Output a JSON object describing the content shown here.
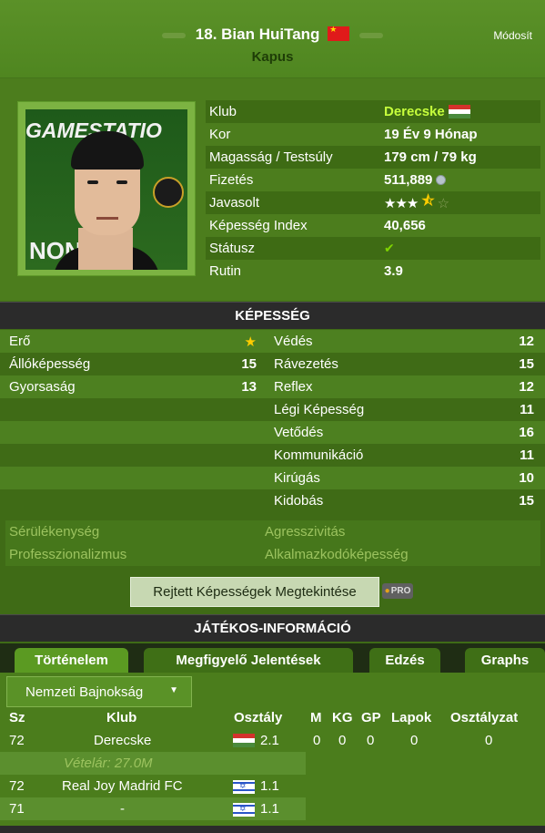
{
  "header": {
    "player_title": "18. Bian HuiTang",
    "position": "Kapus",
    "edit_label": "Módosít"
  },
  "avatar": {
    "banner_top": "GAMESTATIO",
    "banner_bottom": "NON"
  },
  "info": [
    {
      "label": "Klub",
      "value": "Derecske",
      "type": "club"
    },
    {
      "label": "Kor",
      "value": "19 Év 9 Hónap"
    },
    {
      "label": "Magasság / Testsúly",
      "value": "179 cm / 79 kg"
    },
    {
      "label": "Fizetés",
      "value": "511,889",
      "type": "salary"
    },
    {
      "label": "Javasolt",
      "value": "",
      "type": "stars",
      "rating": 3.5,
      "max": 5
    },
    {
      "label": "Képesség Index",
      "value": "40,656"
    },
    {
      "label": "Státusz",
      "value": "",
      "type": "status"
    },
    {
      "label": "Rutin",
      "value": "3.9"
    }
  ],
  "sections": {
    "skills_title": "KÉPESSÉG",
    "player_info_title": "JÁTÉKOS-INFORMÁCIÓ"
  },
  "skills_left": [
    {
      "name": "Erő",
      "value": "★"
    },
    {
      "name": "Állóképesség",
      "value": "15"
    },
    {
      "name": "Gyorsaság",
      "value": "13"
    }
  ],
  "skills_right": [
    {
      "name": "Védés",
      "value": "12"
    },
    {
      "name": "Rávezetés",
      "value": "15"
    },
    {
      "name": "Reflex",
      "value": "12"
    },
    {
      "name": "Légi Képesség",
      "value": "11"
    },
    {
      "name": "Vetődés",
      "value": "16"
    },
    {
      "name": "Kommunikáció",
      "value": "11"
    },
    {
      "name": "Kirúgás",
      "value": "10"
    },
    {
      "name": "Kidobás",
      "value": "15"
    }
  ],
  "hidden_skills": [
    [
      "Sérülékenység",
      "Agresszivitás"
    ],
    [
      "Professzionalizmus",
      "Alkalmazkodóképesség"
    ]
  ],
  "hidden_button": "Rejtett Képességek Megtekintése",
  "pro_badge": "PRO",
  "tabs": [
    "Történelem",
    "Megfigyelő Jelentések",
    "Edzés",
    "Graphs"
  ],
  "history": {
    "dropdown": "Nemzeti Bajnokság",
    "headers": {
      "sz": "Sz",
      "klub": "Klub",
      "osztaly": "Osztály",
      "m": "M",
      "kg": "KG",
      "gp": "GP",
      "lapok": "Lapok",
      "osztalyzat": "Osztályzat"
    },
    "rows": [
      {
        "sz": "72",
        "klub": "Derecske",
        "flag": "hu",
        "osztaly": "2.1",
        "m": "0",
        "kg": "0",
        "gp": "0",
        "lapok": "0",
        "osztalyzat": "0"
      },
      {
        "buy": "Vételár: 27.0M"
      },
      {
        "sz": "72",
        "klub": "Real Joy Madrid FC",
        "flag": "il",
        "osztaly": "1.1"
      },
      {
        "sz": "71",
        "klub": "-",
        "flag": "il",
        "osztaly": "1.1"
      }
    ]
  }
}
